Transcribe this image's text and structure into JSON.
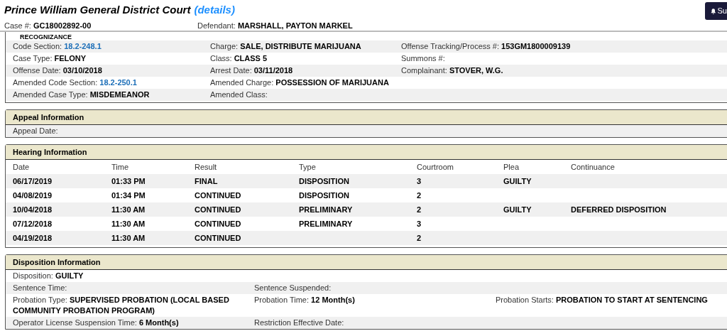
{
  "header": {
    "court": "Prince William General District Court",
    "details_link": "(details)",
    "case_number": {
      "label": "Case #:",
      "value": "GC18002892-00"
    },
    "defendant": {
      "label": "Defendant:",
      "value": "MARSHALL, PAYTON MARKEL"
    },
    "corner_button": "Su"
  },
  "charge_section": {
    "continued_text": "RECOGNIZANCE",
    "rows": [
      [
        {
          "label": "Code Section:",
          "value": "18.2-248.1",
          "link": true
        },
        {
          "label": "Charge:",
          "value": "SALE, DISTRIBUTE MARIJUANA",
          "link": false
        },
        {
          "label": "Offense Tracking/Process #:",
          "value": "153GM1800009139",
          "link": false
        }
      ],
      [
        {
          "label": "Case Type:",
          "value": "FELONY",
          "link": false
        },
        {
          "label": "Class:",
          "value": "CLASS 5",
          "link": false
        },
        {
          "label": "Summons #:"
        }
      ],
      [
        {
          "label": "Offense Date:",
          "value": "03/10/2018",
          "link": false
        },
        {
          "label": "Arrest Date:",
          "value": "03/11/2018",
          "link": false
        },
        {
          "label": "Complainant:",
          "value": "STOVER, W.G.",
          "link": false
        }
      ],
      [
        {
          "label": "Amended Code Section:",
          "value": "18.2-250.1",
          "link": true
        },
        {
          "label": "Amended Charge:",
          "value": "POSSESSION OF MARIJUANA",
          "link": false
        }
      ],
      [
        {
          "label": "Amended Case Type:",
          "value": "MISDEMEANOR",
          "link": false
        },
        {
          "label": "Amended Class:"
        }
      ]
    ]
  },
  "appeal_section": {
    "title": "Appeal Information",
    "rows": [
      [
        {
          "label": "Appeal Date:"
        }
      ]
    ]
  },
  "hearing_section": {
    "title": "Hearing Information",
    "columns": [
      "Date",
      "Time",
      "Result",
      "Type",
      "Courtroom",
      "Plea",
      "Continuance"
    ],
    "rows": [
      [
        "06/17/2019",
        "01:33 PM",
        "FINAL",
        "DISPOSITION",
        "3",
        "GUILTY",
        ""
      ],
      [
        "04/08/2019",
        "01:34 PM",
        "CONTINUED",
        "DISPOSITION",
        "2",
        "",
        ""
      ],
      [
        "10/04/2018",
        "11:30 AM",
        "CONTINUED",
        "PRELIMINARY",
        "2",
        "GUILTY",
        "DEFERRED DISPOSITION"
      ],
      [
        "07/12/2018",
        "11:30 AM",
        "CONTINUED",
        "PRELIMINARY",
        "3",
        "",
        ""
      ],
      [
        "04/19/2018",
        "11:30 AM",
        "CONTINUED",
        "",
        "2",
        "",
        ""
      ]
    ]
  },
  "disposition_section": {
    "title": "Disposition Information",
    "rows": [
      [
        {
          "label": "Disposition:",
          "value": "GUILTY"
        }
      ],
      [
        {
          "label": "Sentence Time:"
        },
        {
          "label": "Sentence Suspended:"
        }
      ],
      [
        {
          "label": "Probation Type:",
          "value": "SUPERVISED PROBATION (LOCAL BASED COMMUNITY PROBATION PROGRAM)"
        },
        {
          "label": "Probation Time:",
          "value": "12 Month(s)"
        },
        {
          "label": "Probation Starts:",
          "value": "PROBATION TO START AT SENTENCING"
        }
      ],
      [
        {
          "label": "Operator License Suspension Time:",
          "value": "6 Month(s)"
        },
        {
          "label": "Restriction Effective Date:"
        }
      ]
    ]
  }
}
